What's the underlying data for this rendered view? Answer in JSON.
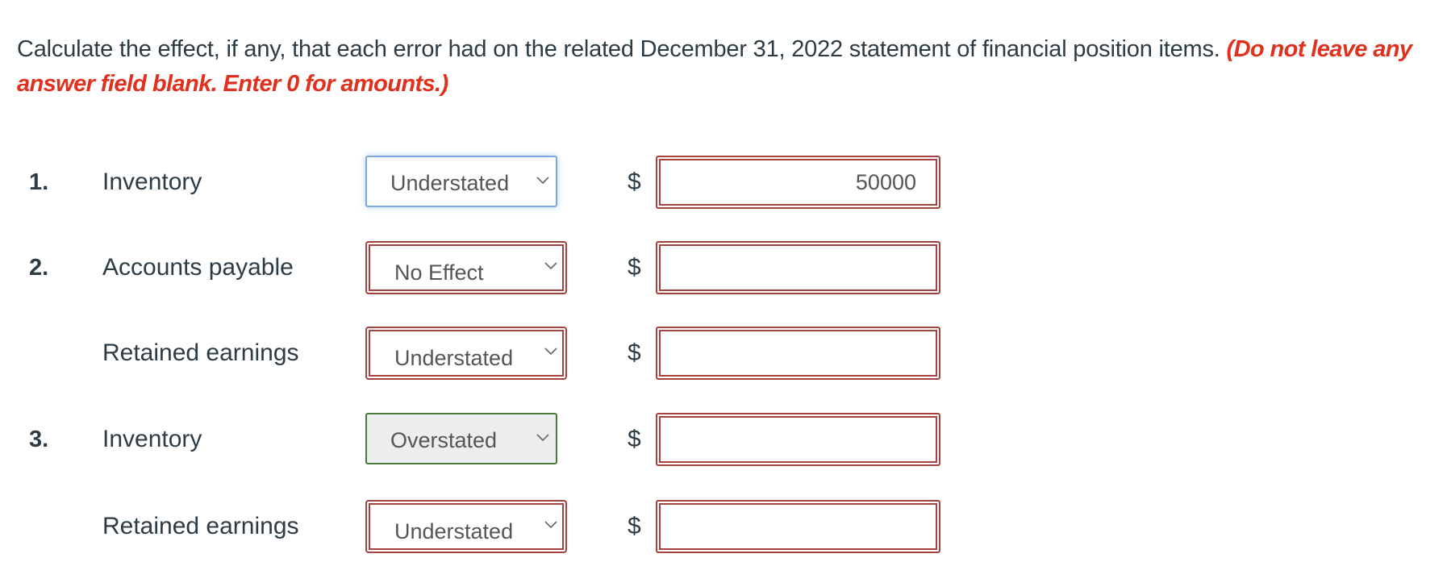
{
  "instructions": {
    "text": "Calculate the effect, if any, that each error had on the related December 31, 2022 statement of financial position items.",
    "note": "(Do not leave any answer field blank. Enter 0 for amounts.)"
  },
  "currency_symbol": "$",
  "rows": [
    {
      "number": "1.",
      "item": "Inventory",
      "effect": "Understated",
      "effect_state": "focused",
      "amount": "50000",
      "amount_state": "error"
    },
    {
      "number": "2.",
      "item": "Accounts payable",
      "effect": "No Effect",
      "effect_state": "error",
      "amount": "",
      "amount_state": "error"
    },
    {
      "number": "",
      "item": "Retained earnings",
      "effect": "Understated",
      "effect_state": "error",
      "amount": "",
      "amount_state": "error"
    },
    {
      "number": "3.",
      "item": "Inventory",
      "effect": "Overstated",
      "effect_state": "correct",
      "amount": "",
      "amount_state": "error"
    },
    {
      "number": "",
      "item": "Retained earnings",
      "effect": "Understated",
      "effect_state": "error",
      "amount": "",
      "amount_state": "error"
    }
  ],
  "colors": {
    "text": "#2d3b45",
    "note_red": "#e0301e",
    "error_border": "#a3423f",
    "correct_border": "#4a7a3a",
    "focus_border": "#7aa9e0"
  },
  "icons": {
    "dropdown": "chevron-down-icon"
  }
}
